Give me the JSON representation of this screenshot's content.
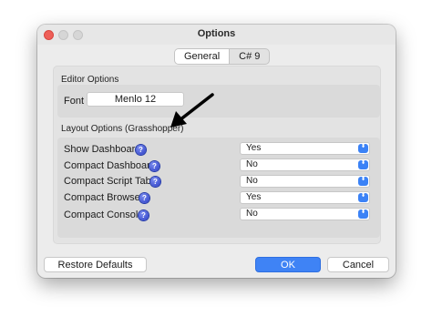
{
  "window": {
    "title": "Options",
    "tabs": [
      {
        "label": "General",
        "selected": true
      },
      {
        "label": "C# 9",
        "selected": false
      }
    ]
  },
  "editor_options": {
    "section_label": "Editor Options",
    "font_label": "Font",
    "font_value": "Menlo 12"
  },
  "layout_options": {
    "section_label": "Layout Options (Grasshopper)",
    "help_glyph": "?",
    "arrow_glyph": "⬍",
    "rows": [
      {
        "label": "Show Dashboard",
        "value": "Yes"
      },
      {
        "label": "Compact Dashboard",
        "value": "No"
      },
      {
        "label": "Compact Script Tabs",
        "value": "No"
      },
      {
        "label": "Compact Browser",
        "value": "Yes"
      },
      {
        "label": "Compact Console",
        "value": "No"
      }
    ]
  },
  "buttons": {
    "restore": "Restore Defaults",
    "ok": "OK",
    "cancel": "Cancel"
  },
  "colors": {
    "accent": "#3f83f5",
    "close": "#ee5f58",
    "help_icon": "#2a3cc4"
  }
}
